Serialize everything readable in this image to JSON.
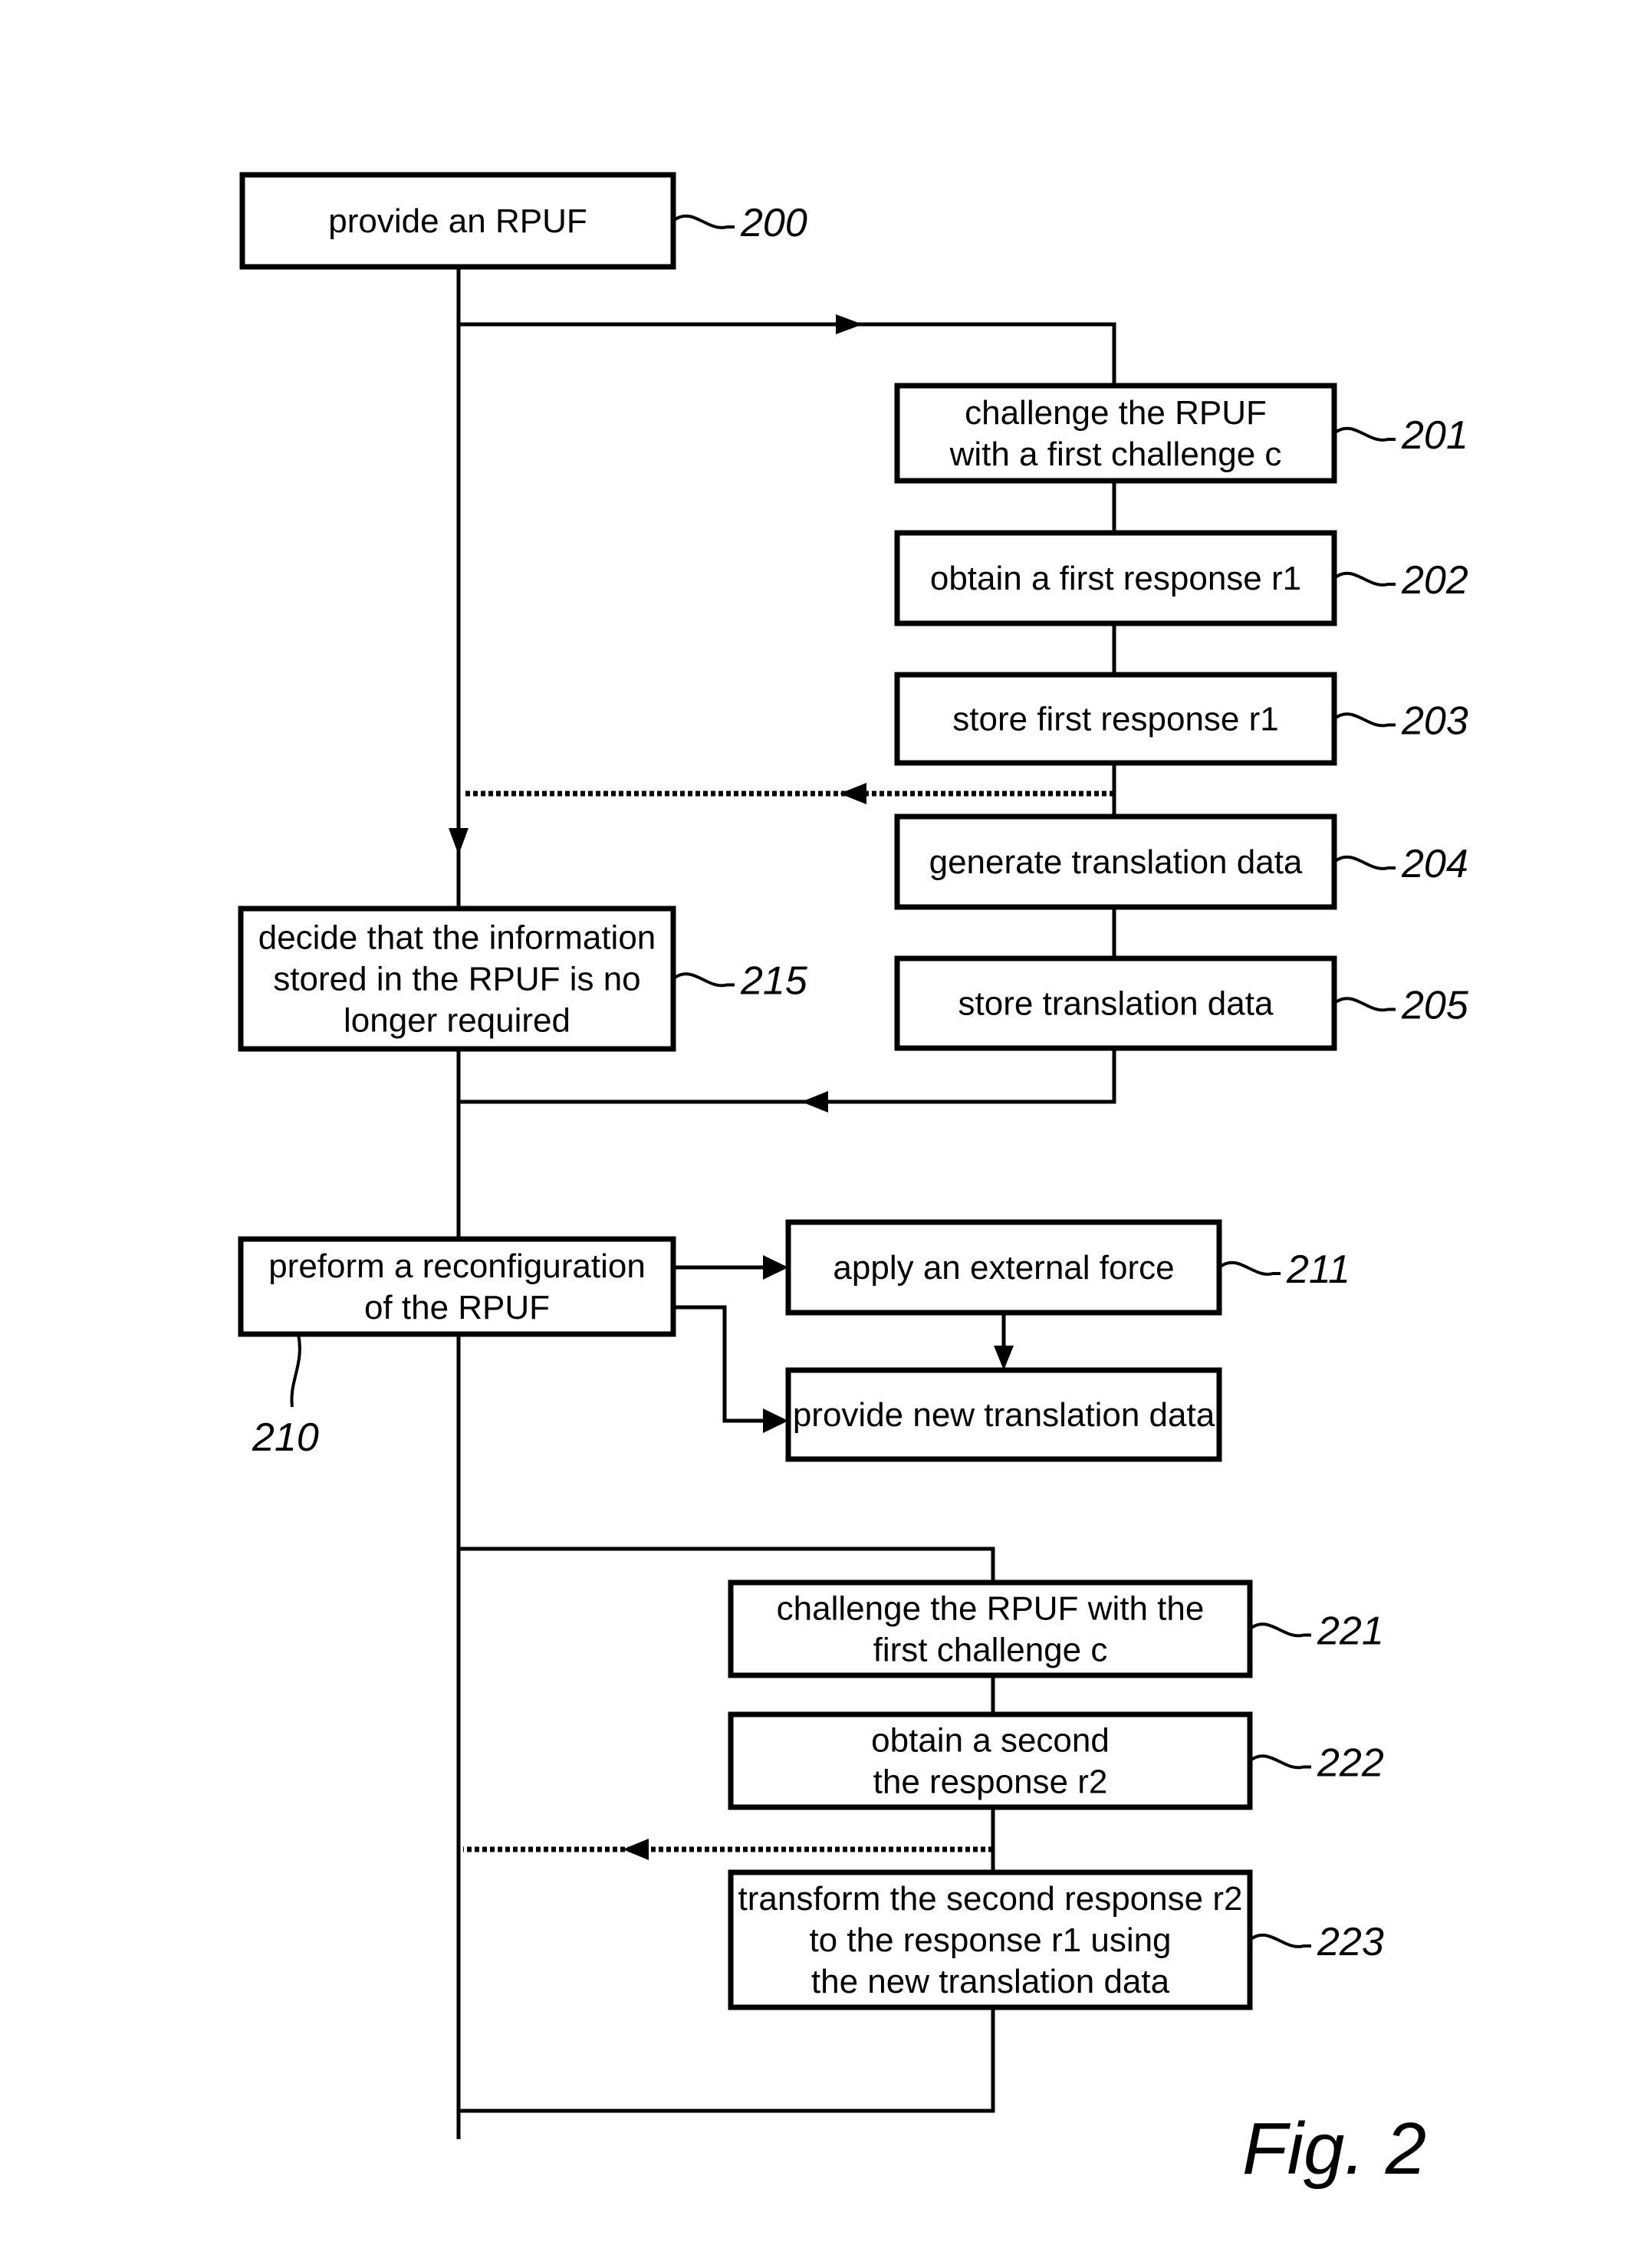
{
  "figure_label": "Fig. 2",
  "steps": {
    "s200": {
      "ref": "200",
      "lines": [
        "provide an RPUF"
      ]
    },
    "s201": {
      "ref": "201",
      "lines": [
        "challenge the RPUF",
        "with a first challenge c"
      ]
    },
    "s202": {
      "ref": "202",
      "lines": [
        "obtain a first response r1"
      ]
    },
    "s203": {
      "ref": "203",
      "lines": [
        "store first response r1"
      ]
    },
    "s204": {
      "ref": "204",
      "lines": [
        "generate translation data"
      ]
    },
    "s205": {
      "ref": "205",
      "lines": [
        "store translation data"
      ]
    },
    "s215": {
      "ref": "215",
      "lines": [
        "decide that the information",
        "stored in the RPUF is no",
        "longer required"
      ]
    },
    "s210": {
      "ref": "210",
      "lines": [
        "preform a reconfiguration",
        "of the RPUF"
      ]
    },
    "s211": {
      "ref": "211",
      "lines": [
        "apply an external force"
      ]
    },
    "s212": {
      "lines": [
        "provide new translation data"
      ]
    },
    "s221": {
      "ref": "221",
      "lines": [
        "challenge the RPUF with the",
        "first challenge c"
      ]
    },
    "s222": {
      "ref": "222",
      "lines": [
        "obtain a second",
        "the response r2"
      ]
    },
    "s223": {
      "ref": "223",
      "lines": [
        "transform the second response r2",
        "to the response r1 using",
        "the new translation data"
      ]
    }
  }
}
